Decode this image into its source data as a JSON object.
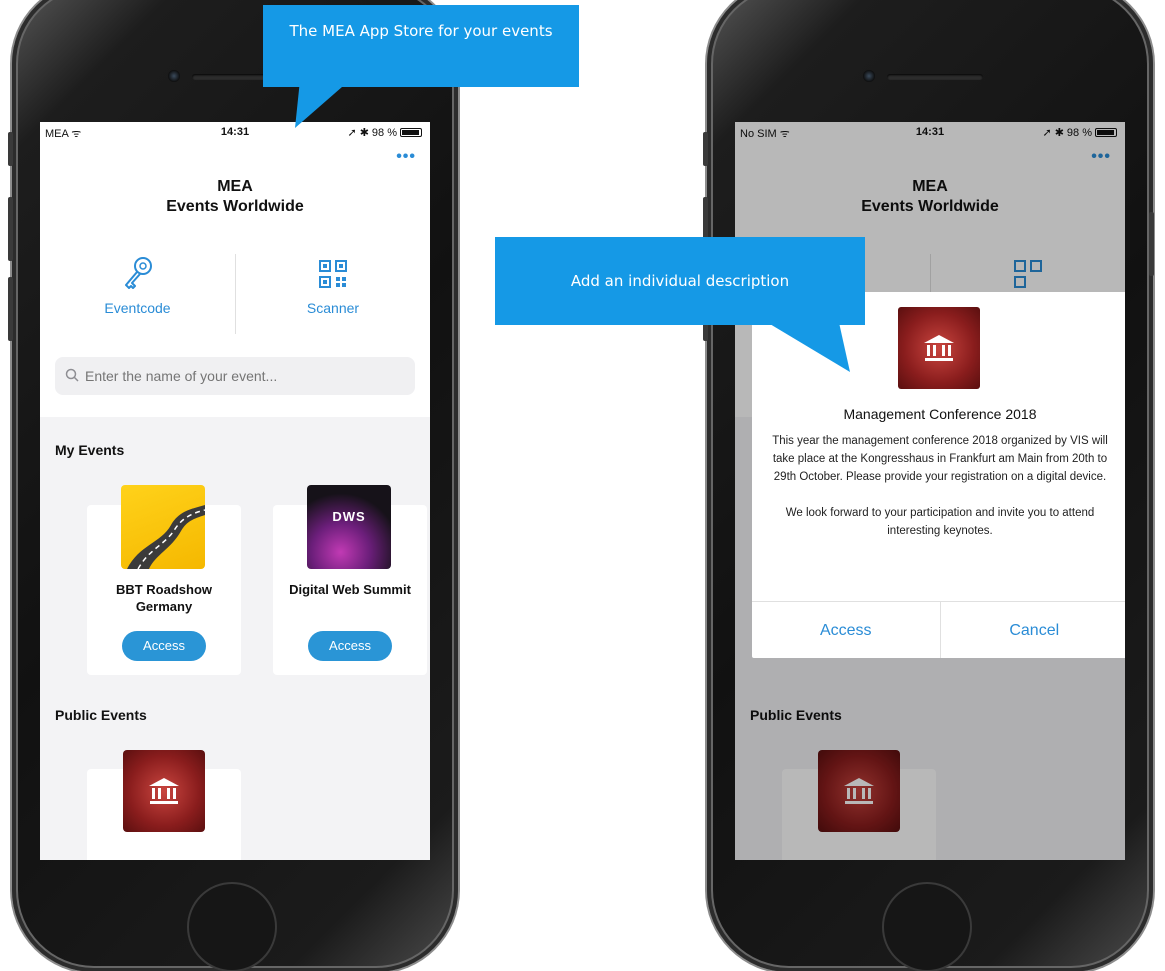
{
  "colors": {
    "accent": "#2a8cd6",
    "callout": "#1599e6",
    "access_button": "#2a95d6"
  },
  "callouts": [
    {
      "text": "The MEA App Store for your events"
    },
    {
      "text": "Add an individual description"
    }
  ],
  "left_phone": {
    "status": {
      "carrier": "MEA ᯤ",
      "time": "14:31",
      "battery": "98 %"
    },
    "menu_icon": "more-dots-icon",
    "title_line1": "MEA",
    "title_line2": "Events Worldwide",
    "actions": [
      {
        "label": "Eventcode",
        "icon": "key-icon"
      },
      {
        "label": "Scanner",
        "icon": "qr-code-icon"
      }
    ],
    "search": {
      "placeholder": "Enter the name of your event..."
    },
    "my_events_title": "My Events",
    "my_events": [
      {
        "name": "BBT Roadshow Germany",
        "button": "Access",
        "thumb": "road-image"
      },
      {
        "name": "Digital Web Summit",
        "button": "Access",
        "thumb": "dws-image",
        "thumb_text": "DWS"
      }
    ],
    "public_events_title": "Public Events"
  },
  "right_phone": {
    "status": {
      "carrier": "No SIM ᯤ",
      "time": "14:31",
      "battery": "98 %"
    },
    "title_line1": "MEA",
    "title_line2": "Events Worldwide",
    "public_events_title": "Public Events",
    "dialog": {
      "title": "Management Conference 2018",
      "body": "This year the management conference 2018 organized by VIS will take place at the Kongresshaus in Frankfurt am Main from 20th to 29th October. Please provide your registration on a digital device.\n\nWe look forward to your participation and invite you to attend interesting keynotes.",
      "access": "Access",
      "cancel": "Cancel"
    }
  }
}
